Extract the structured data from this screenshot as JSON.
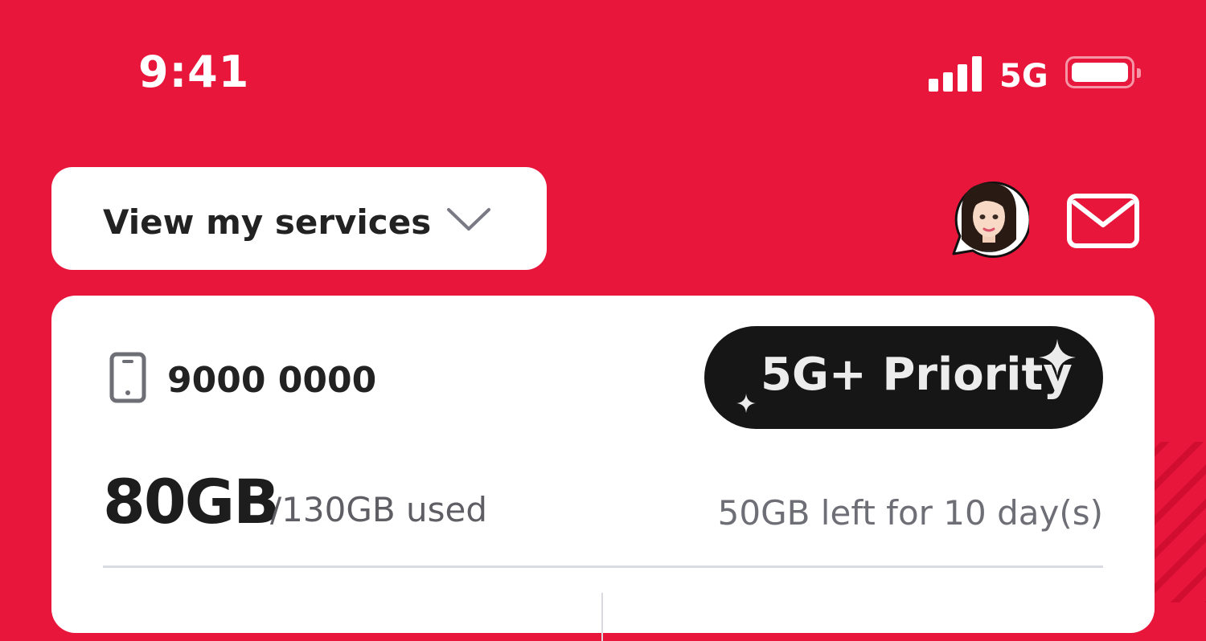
{
  "colors": {
    "brand_red": "#E8163A",
    "badge_bg": "#161616",
    "text_dark": "#222222",
    "text_muted": "#6E6E76"
  },
  "status_bar": {
    "time": "9:41",
    "network": "5G",
    "icons": [
      "signal-icon",
      "battery-icon"
    ]
  },
  "header": {
    "services_button": {
      "label": "View my services",
      "icon": "chevron-down-icon"
    },
    "avatar": {
      "icon": "assistant-avatar-icon"
    },
    "mail": {
      "icon": "mail-icon"
    }
  },
  "card": {
    "phone_icon": "mobile-phone-icon",
    "phone_number": "9000 0000",
    "badge": {
      "label": "5G+ Priority",
      "icon": "sparkle-icon"
    },
    "usage": {
      "used": "80GB",
      "total": "/130GB used",
      "remaining": "50GB left for 10 day(s)"
    }
  }
}
